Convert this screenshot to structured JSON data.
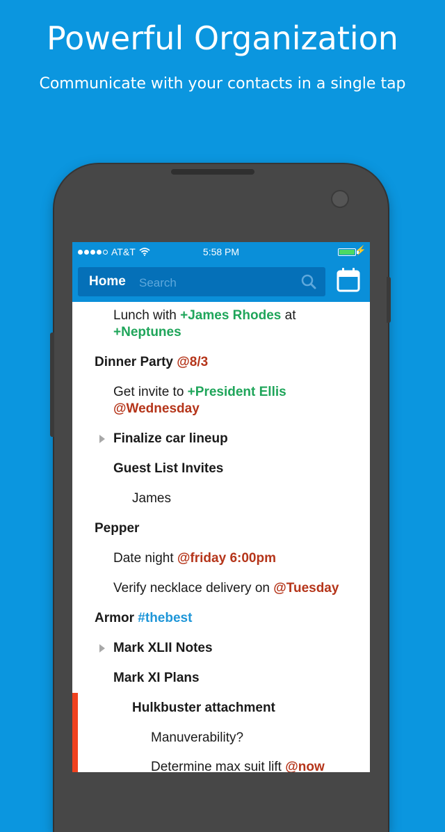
{
  "promo": {
    "title": "Powerful Organization",
    "subtitle": "Communicate with your contacts in a single tap"
  },
  "statusbar": {
    "carrier": "AT&T",
    "time": "5:58 PM",
    "signal_dots": 5,
    "signal_filled": 4,
    "battery_color": "#4cd964"
  },
  "navbar": {
    "home_label": "Home",
    "search_placeholder": "Search",
    "search_icon": "search-icon",
    "calendar_icon": "calendar-icon"
  },
  "colors": {
    "brand_blue": "#0b96df",
    "contact_green": "#1fa55a",
    "date_red": "#b5351a",
    "tag_blue": "#1e96d8",
    "focus_bar": "#f0421f"
  },
  "items": [
    {
      "parts": [
        {
          "t": "Lunch with ",
          "k": "text"
        },
        {
          "t": "+James Rhodes",
          "k": "contact"
        },
        {
          "t": " at",
          "k": "text"
        }
      ]
    },
    {
      "parts": [
        {
          "t": "+Neptunes",
          "k": "contact"
        }
      ]
    },
    {
      "parts": [
        {
          "t": "Dinner Party ",
          "k": "bold"
        },
        {
          "t": "@8/3",
          "k": "date"
        }
      ]
    },
    {
      "parts": [
        {
          "t": "Get invite to ",
          "k": "text"
        },
        {
          "t": "+President Ellis",
          "k": "contact"
        }
      ]
    },
    {
      "parts": [
        {
          "t": "@Wednesday",
          "k": "date"
        }
      ]
    },
    {
      "parts": [
        {
          "t": "Finalize car lineup",
          "k": "bold"
        }
      ]
    },
    {
      "parts": [
        {
          "t": "Guest List Invites",
          "k": "bold"
        }
      ]
    },
    {
      "parts": [
        {
          "t": "James",
          "k": "text"
        }
      ]
    },
    {
      "parts": [
        {
          "t": "Pepper",
          "k": "bold"
        }
      ]
    },
    {
      "parts": [
        {
          "t": "Date night ",
          "k": "text"
        },
        {
          "t": "@friday 6:00pm",
          "k": "date"
        }
      ]
    },
    {
      "parts": [
        {
          "t": "Verify necklace delivery on ",
          "k": "text"
        },
        {
          "t": "@Tuesday",
          "k": "date"
        }
      ]
    },
    {
      "parts": [
        {
          "t": "Armor ",
          "k": "bold"
        },
        {
          "t": "#thebest",
          "k": "tag"
        }
      ]
    },
    {
      "parts": [
        {
          "t": "Mark XLII Notes",
          "k": "bold"
        }
      ]
    },
    {
      "parts": [
        {
          "t": "Mark XI Plans",
          "k": "bold"
        }
      ]
    },
    {
      "parts": [
        {
          "t": "Hulkbuster attachment",
          "k": "bold"
        }
      ]
    },
    {
      "parts": [
        {
          "t": "Manuverability?",
          "k": "text"
        }
      ]
    },
    {
      "parts": [
        {
          "t": "Determine max suit lift ",
          "k": "text"
        },
        {
          "t": "@now",
          "k": "date"
        }
      ]
    }
  ]
}
